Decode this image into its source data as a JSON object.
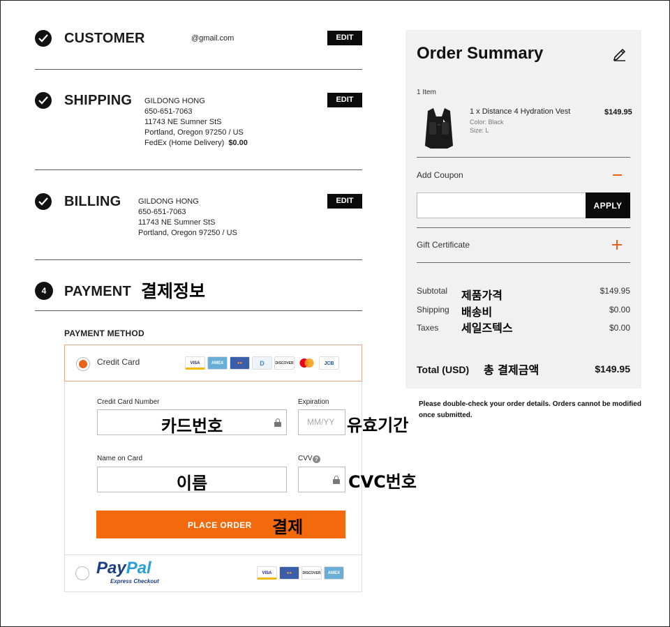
{
  "steps": {
    "customer": {
      "title": "CUSTOMER",
      "email": "@gmail.com",
      "edit_label": "EDIT"
    },
    "shipping": {
      "title": "SHIPPING",
      "name": "GILDONG HONG",
      "phone": "650-651-7063",
      "street": "11743 NE Sumner StS",
      "city": "Portland, Oregon 97250 / US",
      "method": "FedEx (Home Delivery)",
      "cost": "$0.00",
      "edit_label": "EDIT"
    },
    "billing": {
      "title": "BILLING",
      "name": "GILDONG HONG",
      "phone": "650-651-7063",
      "street": "11743 NE Sumner StS",
      "city": "Portland, Oregon 97250 / US",
      "edit_label": "EDIT"
    },
    "payment": {
      "number": "4",
      "title": "PAYMENT",
      "annotation": "결제정보"
    }
  },
  "payment": {
    "method_label": "PAYMENT METHOD",
    "credit_card_label": "Credit Card",
    "card_logos": [
      "VISA",
      "AMEX",
      "MC",
      "D",
      "DISCOVER",
      "MASTERCARD",
      "JCB"
    ],
    "card_number_label": "Credit Card Number",
    "card_number_annotation": "카드번호",
    "expiration_label": "Expiration",
    "expiration_placeholder": "MM/YY",
    "expiration_annotation": "유효기간",
    "name_label": "Name on Card",
    "name_annotation": "이름",
    "cvv_label": "CVV",
    "cvv_help": "?",
    "cvv_annotation": "CVC번호",
    "place_order_label": "PLACE ORDER",
    "place_order_annotation": "결제",
    "paypal_pay": "Pay",
    "paypal_pal": "Pal",
    "paypal_sub": "Express Checkout",
    "paypal_logos": [
      "VISA",
      "MC",
      "DISCOVER",
      "AMEX"
    ]
  },
  "summary": {
    "title": "Order Summary",
    "item_count": "1 Item",
    "item": {
      "name": "1 x Distance 4 Hydration Vest",
      "color": "Color: Black",
      "size": "Size: L",
      "price": "$149.95"
    },
    "coupon_label": "Add Coupon",
    "apply_label": "APPLY",
    "gift_label": "Gift Certificate",
    "subtotal_label": "Subtotal",
    "subtotal_annotation": "제품가격",
    "subtotal_value": "$149.95",
    "shipping_label": "Shipping",
    "shipping_annotation": "배송비",
    "shipping_value": "$0.00",
    "taxes_label": "Taxes",
    "taxes_annotation": "세일즈텍스",
    "taxes_value": "$0.00",
    "total_label": "Total (USD)",
    "total_annotation": "총 결제금액",
    "total_value": "$149.95",
    "notice": "Please double-check your order details. Orders cannot be modified once submitted."
  },
  "colors": {
    "accent": "#f26a0c",
    "dark": "#0b0b0b",
    "summary_bg": "#f1f1f1",
    "paypal_blue": "#1c3f86",
    "paypal_light": "#2a9fd8"
  }
}
